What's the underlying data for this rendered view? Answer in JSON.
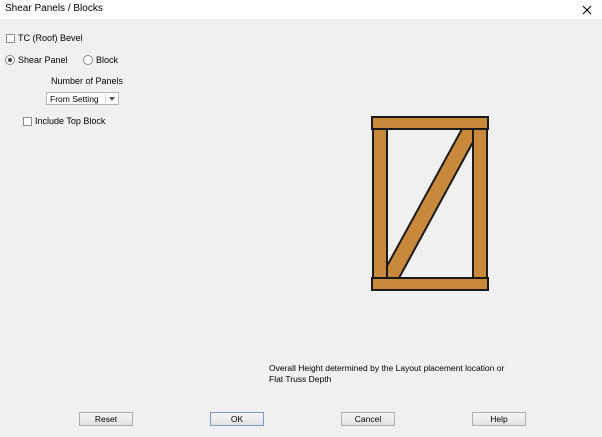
{
  "window": {
    "title": "Shear Panels / Blocks",
    "close_icon": "close-icon"
  },
  "options": {
    "tc_bevel_label": "TC (Roof) Bevel",
    "tc_bevel_checked": false,
    "shear_panel_label": "Shear Panel",
    "shear_panel_selected": true,
    "block_label": "Block",
    "block_selected": false,
    "num_panels_label": "Number of Panels",
    "num_panels_value": "From Setting",
    "include_top_block_label": "Include Top Block",
    "include_top_block_checked": false
  },
  "note": {
    "line1": "Overall Height determined by the Layout placement location or",
    "line2": "Flat Truss Depth"
  },
  "buttons": {
    "reset": "Reset",
    "ok": "OK",
    "cancel": "Cancel",
    "help": "Help"
  },
  "colors": {
    "wood": "#c8893a",
    "outline": "#1a1a1a",
    "background": "#f0f0f0"
  }
}
